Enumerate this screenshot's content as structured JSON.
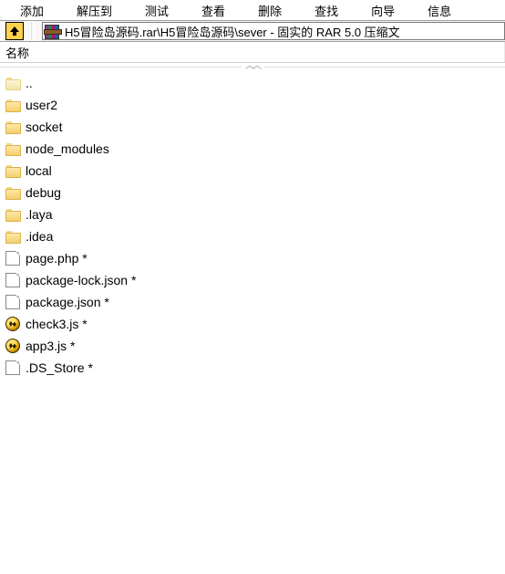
{
  "menu": {
    "add": "添加",
    "extract_to": "解压到",
    "test": "测试",
    "view": "查看",
    "delete": "删除",
    "find": "查找",
    "wizard": "向导",
    "info": "信息"
  },
  "path": "H5冒险岛源码.rar\\H5冒险岛源码\\sever - 固实的 RAR 5.0 压缩文",
  "columns": {
    "name": "名称"
  },
  "items": [
    {
      "icon": "folder-dim",
      "label": ".."
    },
    {
      "icon": "folder",
      "label": "user2"
    },
    {
      "icon": "folder",
      "label": "socket"
    },
    {
      "icon": "folder",
      "label": "node_modules"
    },
    {
      "icon": "folder",
      "label": "local"
    },
    {
      "icon": "folder",
      "label": "debug"
    },
    {
      "icon": "folder",
      "label": ".laya"
    },
    {
      "icon": "folder",
      "label": ".idea"
    },
    {
      "icon": "file",
      "label": "page.php *"
    },
    {
      "icon": "file",
      "label": "package-lock.json *"
    },
    {
      "icon": "file",
      "label": "package.json *"
    },
    {
      "icon": "js",
      "label": "check3.js *"
    },
    {
      "icon": "js",
      "label": "app3.js *"
    },
    {
      "icon": "file",
      "label": ".DS_Store *"
    }
  ]
}
